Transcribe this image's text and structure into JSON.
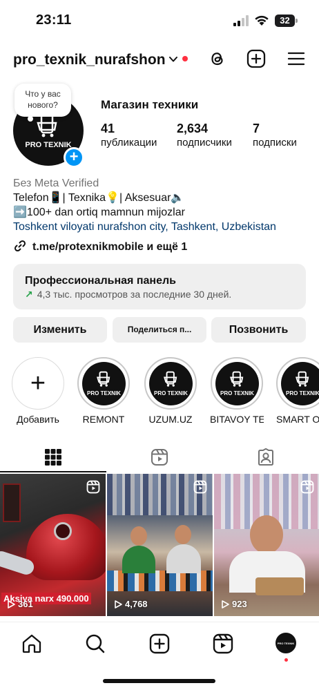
{
  "status_bar": {
    "time": "23:11",
    "battery": "32"
  },
  "header": {
    "username": "pro_texnik_nurafshon"
  },
  "profile": {
    "note": "Что у вас нового?",
    "avatar_text": "PRO TEXNIK",
    "name": "Магазин техники",
    "stats": [
      {
        "value": "41",
        "label": "публикации"
      },
      {
        "value": "2,634",
        "label": "подписчики"
      },
      {
        "value": "7",
        "label": "подписки"
      }
    ],
    "meta_verified": "Без Meta Verified",
    "bio_line1": "Telefon📱| Texnika💡| Aksesuar🔈",
    "bio_line2": "➡️100+ dan ortiq mamnun mijozlar",
    "location": "Toshkent viloyati nurafshon city, Tashkent, Uzbekistan",
    "link": "t.me/protexnikmobile и ещё 1"
  },
  "pro_panel": {
    "title": "Профессиональная панель",
    "subtitle": "4,3 тыс. просмотров за последние 30 дней."
  },
  "buttons": {
    "edit": "Изменить",
    "share": "Поделиться п...",
    "call": "Позвонить"
  },
  "highlights": [
    {
      "label": "Добавить",
      "type": "add"
    },
    {
      "label": "REMONT",
      "type": "story",
      "logo": "PRO TEXNIK"
    },
    {
      "label": "UZUM.UZ",
      "type": "story",
      "logo": "PRO TEXNIK"
    },
    {
      "label": "BITAVOY TE...",
      "type": "story",
      "logo": "PRO TEXNIK"
    },
    {
      "label": "SMART O",
      "type": "story",
      "logo": "PRO TEXNIK"
    }
  ],
  "posts": [
    {
      "views": "361",
      "overlay": "Aksiya narx 490.000"
    },
    {
      "views": "4,768"
    },
    {
      "views": "923"
    }
  ],
  "nav_avatar_text": "PRO TEXNIK",
  "colors": {
    "accent": "#0095f6",
    "notification": "#ff3040",
    "link": "#00376b",
    "promo": "#d11f2e"
  },
  "icons": [
    "threads-icon",
    "plus-square-icon",
    "hamburger-icon",
    "grid-icon",
    "reels-icon",
    "tagged-icon",
    "home-icon",
    "search-icon",
    "reels-nav-icon"
  ]
}
